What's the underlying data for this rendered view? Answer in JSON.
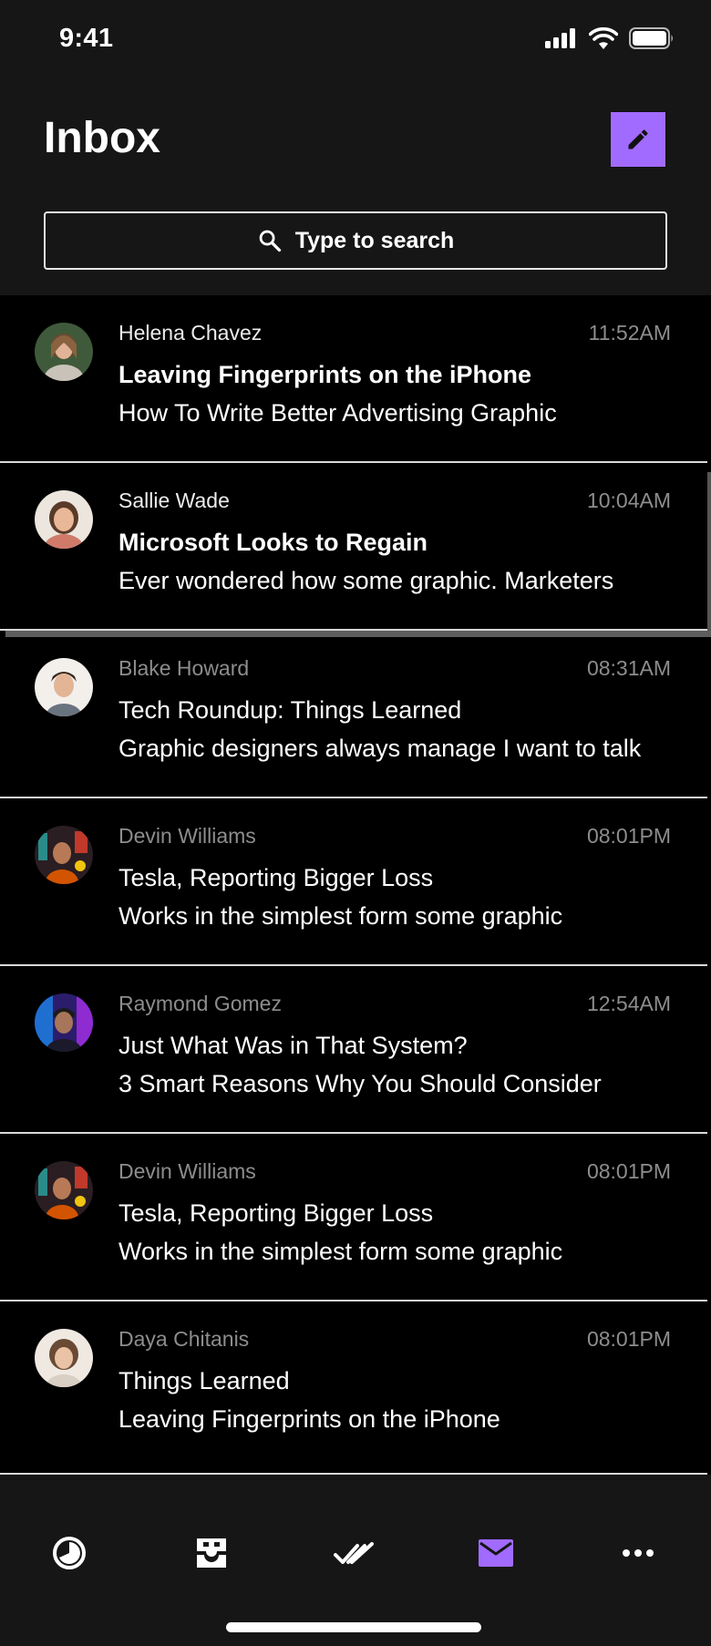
{
  "status_bar": {
    "time": "9:41"
  },
  "header": {
    "title": "Inbox",
    "compose_icon": "pencil-icon"
  },
  "search": {
    "placeholder": "Type to search",
    "value": ""
  },
  "messages": [
    {
      "sender": "Helena Chavez",
      "time": "11:52AM",
      "subject": "Leaving Fingerprints on the iPhone",
      "preview": "How To Write Better Advertising Graphic",
      "unread": true
    },
    {
      "sender": "Sallie Wade",
      "time": "10:04AM",
      "subject": "Microsoft Looks to Regain",
      "preview": "Ever wondered how some graphic. Marketers",
      "unread": true
    },
    {
      "sender": "Blake Howard",
      "time": "08:31AM",
      "subject": "Tech Roundup: Things Learned",
      "preview": "Graphic designers always manage I want to talk",
      "unread": false
    },
    {
      "sender": "Devin Williams",
      "time": "08:01PM",
      "subject": "Tesla, Reporting Bigger Loss",
      "preview": "Works in the simplest form some graphic",
      "unread": false
    },
    {
      "sender": "Raymond Gomez",
      "time": "12:54AM",
      "subject": "Just What Was in That System?",
      "preview": "3 Smart Reasons Why You Should Consider",
      "unread": false
    },
    {
      "sender": "Devin Williams",
      "time": "08:01PM",
      "subject": "Tesla, Reporting Bigger Loss",
      "preview": "Works in the simplest form some graphic",
      "unread": false
    },
    {
      "sender": "Daya Chitanis",
      "time": "08:01PM",
      "subject": "Things Learned",
      "preview": "Leaving Fingerprints on the iPhone",
      "unread": false
    }
  ],
  "tabbar": {
    "tabs": [
      {
        "icon": "clock-icon",
        "active": false
      },
      {
        "icon": "archive-tray-icon",
        "active": false
      },
      {
        "icon": "double-check-icon",
        "active": false
      },
      {
        "icon": "envelope-icon",
        "active": true
      },
      {
        "icon": "more-dots-icon",
        "active": false
      }
    ]
  },
  "colors": {
    "accent": "#a26bff",
    "background": "#161616",
    "list_background": "#000000",
    "muted_text": "#8d8d8d"
  }
}
